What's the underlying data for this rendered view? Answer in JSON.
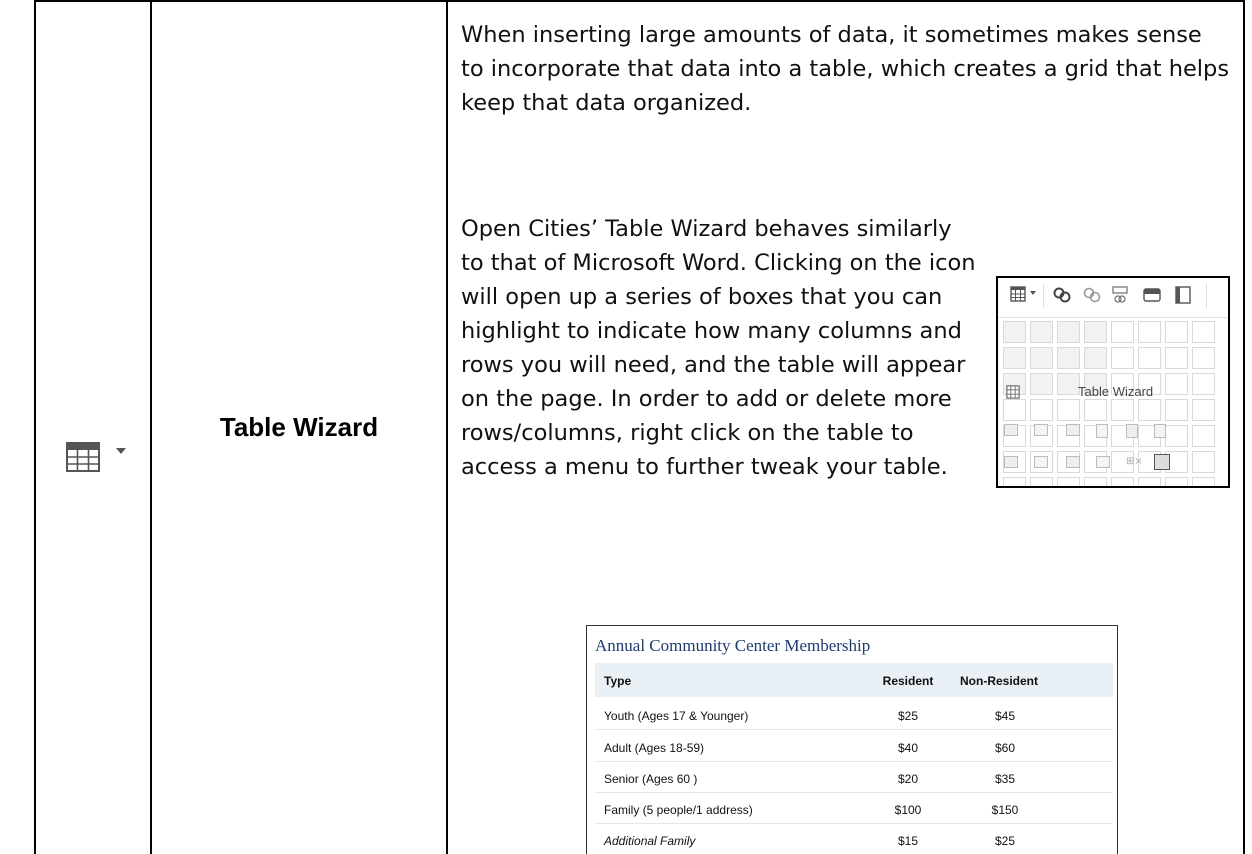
{
  "feature": {
    "name": "Table Wizard",
    "icon": "table-grid-icon",
    "dropdown_icon": "caret-down-icon"
  },
  "description": {
    "paragraph1": "When inserting large amounts of data, it sometimes makes sense to incorporate that data into a table, which creates a grid that helps keep that data organized.",
    "paragraph2": "Open Cities’ Table Wizard behaves similarly to that of Microsoft Word. Clicking on the icon will open up a series of boxes that you can highlight to indicate how many columns and rows you will need, and the table will appear on the page. In order to add or delete more rows/columns, right click on the table to access a menu to further tweak your table."
  },
  "toolbar_screenshot": {
    "menu_label": "Table Wizard",
    "toolbar_icons": [
      "table-grid-icon",
      "caret-down-icon",
      "link-icon",
      "unlink-icon",
      "anchor-icon",
      "widget-icon",
      "document-icon"
    ],
    "cell_table_icons": [
      "table-properties-icon",
      "cell-properties-icon",
      "insert-row-icon",
      "insert-column-icon",
      "merge-cells-icon",
      "split-cells-icon",
      "delete-row-icon",
      "delete-column-icon",
      "delete-cell-icon",
      "delete-table-icon",
      "edit-table-icon"
    ]
  },
  "membership_table": {
    "title": "Annual Community Center Membership",
    "headers": [
      "Type",
      "Resident",
      "Non-Resident"
    ],
    "rows": [
      [
        "Youth (Ages 17 & Younger)",
        "$25",
        "$45"
      ],
      [
        "Adult (Ages 18-59)",
        "$40",
        "$60"
      ],
      [
        "Senior (Ages 60 )",
        "$20",
        "$35"
      ],
      [
        "Family (5 people/1 address)",
        "$100",
        "$150"
      ],
      [
        "Additional Family",
        "$15",
        "$25"
      ]
    ]
  },
  "colors": {
    "title_blue": "#1f3b6e",
    "header_bg": "#e9f0f6",
    "grid_highlight": "#f2f2f2"
  }
}
